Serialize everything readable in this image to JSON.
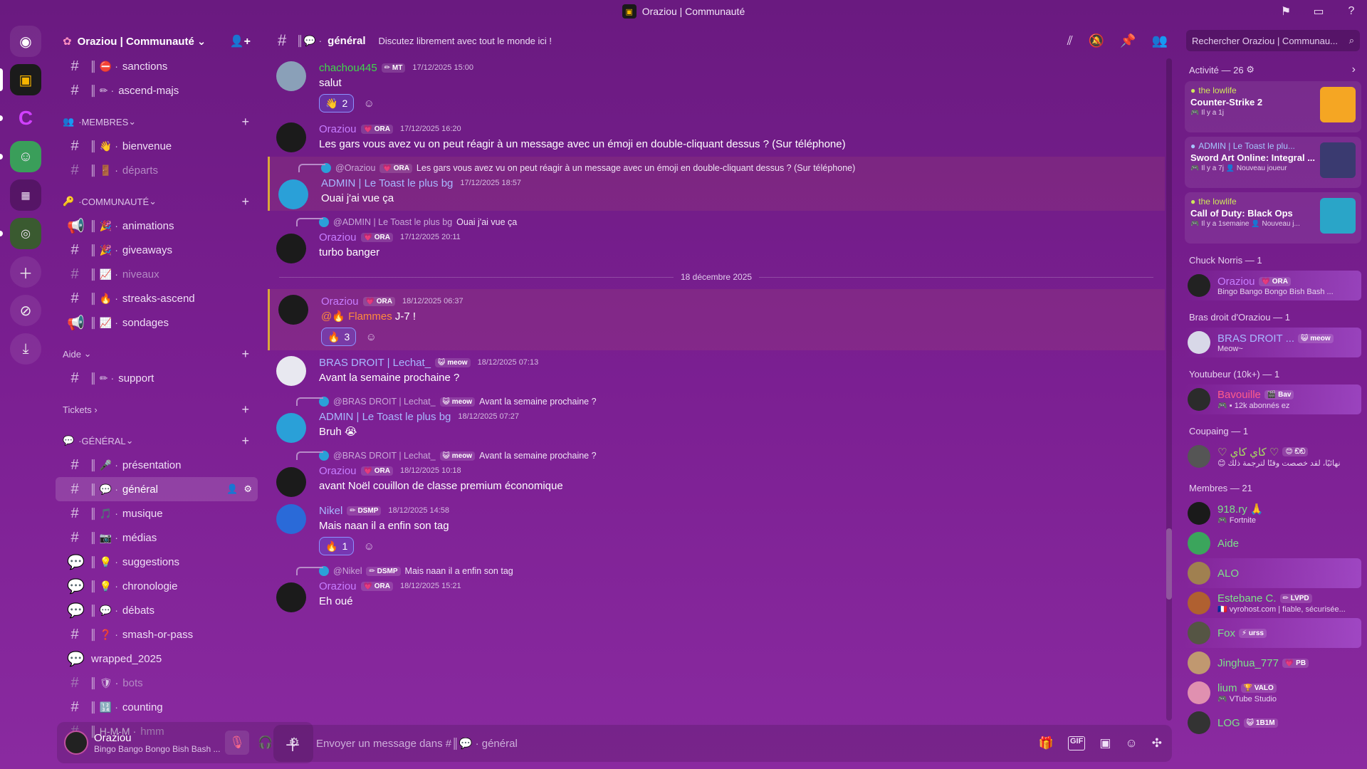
{
  "window": {
    "title": "Oraziou | Communauté"
  },
  "sidebar": {
    "guild_name": "Oraziou | Communauté",
    "top_channels": [
      {
        "name": "sanctions",
        "emoji": "⛔",
        "muted": false
      },
      {
        "name": "ascend-majs",
        "emoji": "✏",
        "muted": false
      }
    ],
    "cat_membres": "MEMBRES",
    "membres_channels": [
      {
        "name": "bienvenue",
        "emoji": "👋",
        "muted": false
      },
      {
        "name": "départs",
        "emoji": "🚪",
        "muted": true
      }
    ],
    "cat_communaute": "COMMUNAUTÉ",
    "communaute_channels": [
      {
        "name": "animations",
        "emoji": "🎉",
        "muted": false,
        "icon": "📢"
      },
      {
        "name": "giveaways",
        "emoji": "🎉",
        "muted": false,
        "icon": "#"
      },
      {
        "name": "niveaux",
        "emoji": "📈",
        "muted": true,
        "icon": "#"
      },
      {
        "name": "streaks-ascend",
        "emoji": "🔥",
        "muted": false,
        "icon": "#"
      },
      {
        "name": "sondages",
        "emoji": "📈",
        "muted": false,
        "icon": "📢"
      }
    ],
    "cat_aide": "Aide",
    "aide_channels": [
      {
        "name": "support",
        "emoji": "✏",
        "muted": false
      }
    ],
    "cat_tickets": "Tickets",
    "cat_general": "GÉNÉRAL",
    "general_channels": [
      {
        "name": "présentation",
        "emoji": "🎤",
        "muted": false,
        "icon": "#"
      },
      {
        "name": "général",
        "emoji": "💬",
        "muted": false,
        "icon": "#",
        "active": true
      },
      {
        "name": "musique",
        "emoji": "🎵",
        "muted": false,
        "icon": "#"
      },
      {
        "name": "médias",
        "emoji": "📷",
        "muted": false,
        "icon": "#"
      },
      {
        "name": "suggestions",
        "emoji": "💡",
        "muted": false,
        "icon": "💬"
      },
      {
        "name": "chronologie",
        "emoji": "💡",
        "muted": false,
        "icon": "💬"
      },
      {
        "name": "débats",
        "emoji": "💬",
        "muted": false,
        "icon": "💬"
      },
      {
        "name": "smash-or-pass",
        "emoji": "❓",
        "muted": false,
        "icon": "#"
      },
      {
        "name": "wrapped_2025",
        "emoji": "",
        "muted": false,
        "icon": "💬",
        "plain": true
      },
      {
        "name": "bots",
        "emoji": "🛡",
        "muted": true,
        "icon": "#"
      },
      {
        "name": "counting",
        "emoji": "🔢",
        "muted": false,
        "icon": "#"
      },
      {
        "name": "hmm",
        "emoji": "H-M-M",
        "muted": true,
        "icon": "#"
      }
    ],
    "user": {
      "name": "Oraziou",
      "status": "Bingo Bango Bongo Bish Bash ..."
    }
  },
  "chat": {
    "channel": "général",
    "topic": "Discutez librement avec tout le monde ici !",
    "search_placeholder": "Rechercher Oraziou | Communau...",
    "composer_placeholder": "Envoyer un message dans #║💬 · général",
    "date_divider": "18 décembre 2025",
    "messages": [
      {
        "author": "chachou445",
        "tag": "✏ MT",
        "color": "#3fd94a",
        "time": "17/12/2025 15:00",
        "text": "salut",
        "reactions": [
          {
            "emoji": "👋",
            "count": "2"
          }
        ]
      },
      {
        "author": "Oraziou",
        "tag": "💗 ORA",
        "color": "#c77dff",
        "time": "17/12/2025 16:20",
        "text": "Les gars vous avez vu on peut réagir à un message avec un émoji en double-cliquant dessus ? (Sur téléphone)"
      },
      {
        "reply_author": "@Oraziou",
        "reply_tag": "💗 ORA",
        "reply_text": "Les gars vous avez vu on peut réagir à un message avec un émoji en double-cliquant dessus ? (Sur téléphone)",
        "author": "ADMIN | Le Toast le plus bg",
        "color": "#a8b8ff",
        "time": "17/12/2025 18:57",
        "text": "Ouai j'ai vue ça",
        "mention": true
      },
      {
        "reply_author": "@ADMIN | Le Toast le plus bg",
        "reply_text": "Ouai j'ai vue ça",
        "author": "Oraziou",
        "tag": "💗 ORA",
        "color": "#c77dff",
        "time": "17/12/2025 20:11",
        "text": "turbo banger"
      },
      {
        "author": "Oraziou",
        "tag": "💗 ORA",
        "color": "#c77dff",
        "time": "18/12/2025 06:37",
        "ping": "@🔥 Flammes",
        "text": " J-7 !",
        "reactions": [
          {
            "emoji": "🔥",
            "count": "3"
          }
        ],
        "mention": true
      },
      {
        "author": "BRAS DROIT | Lechat_",
        "tag": "😺 meow",
        "color": "#a8b8ff",
        "time": "18/12/2025 07:13",
        "text": "Avant la semaine prochaine ?"
      },
      {
        "reply_author": "@BRAS DROIT | Lechat_",
        "reply_tag": "😺 meow",
        "reply_text": "Avant la semaine prochaine ?",
        "author": "ADMIN | Le Toast le plus bg",
        "color": "#a8b8ff",
        "time": "18/12/2025 07:27",
        "text": "Bruh 😭"
      },
      {
        "reply_author": "@BRAS DROIT | Lechat_",
        "reply_tag": "😺 meow",
        "reply_text": "Avant la semaine prochaine ?",
        "author": "Oraziou",
        "tag": "💗 ORA",
        "color": "#c77dff",
        "time": "18/12/2025 10:18",
        "text": "avant Noël couillon de classe premium économique"
      },
      {
        "author": "Nikel",
        "tag": "✏ DSMP",
        "color": "#a8b8ff",
        "time": "18/12/2025 14:58",
        "text": "Mais naan il a enfin son tag",
        "reactions": [
          {
            "emoji": "🔥",
            "count": "1"
          }
        ]
      },
      {
        "reply_author": "@Nikel",
        "reply_tag": "✏ DSMP",
        "reply_text": "Mais naan il a enfin son tag",
        "author": "Oraziou",
        "tag": "💗 ORA",
        "color": "#c77dff",
        "time": "18/12/2025 15:21",
        "text": "Eh oué"
      }
    ]
  },
  "members": {
    "activity_header": "Activité — 26",
    "activities": [
      {
        "user": "the lowlife",
        "game": "Counter-Strike 2",
        "sub": "🎮 Il y a 1j",
        "img_color": "#f5a623",
        "blue": false
      },
      {
        "user": "ADMIN | Le Toast le plu...",
        "game": "Sword Art Online: Integral ...",
        "sub": "🎮 Il y a 7j  👤 Nouveau joueur",
        "img_color": "#3a3a70",
        "blue": true
      },
      {
        "user": "the lowlife",
        "game": "Call of Duty: Black Ops",
        "sub": "🎮 Il y a 1semaine  👤 Nouveau j...",
        "img_color": "#2aa5c8",
        "blue": false
      }
    ],
    "groups": [
      {
        "title": "Chuck Norris — 1",
        "list": [
          {
            "name": "Oraziou",
            "tag": "💗 ORA",
            "color": "#c77dff",
            "sub": "Bingo Bango Bongo Bish Bash ...",
            "banner": true,
            "av": "#222"
          }
        ]
      },
      {
        "title": "Bras droit d'Oraziou — 1",
        "list": [
          {
            "name": "BRAS DROIT ...",
            "tag": "😺 meow",
            "color": "#a8b8ff",
            "sub": "Meow~",
            "banner": true,
            "av": "#d8d8e8"
          }
        ]
      },
      {
        "title": "Youtubeur (10k+) — 1",
        "list": [
          {
            "name": "Bavouille",
            "tag": "🎬 Bav",
            "color": "#ff5b8a",
            "sub": "🎮 ▪ 12k abonnés ez",
            "banner": true,
            "av": "#2b2b2b"
          }
        ]
      },
      {
        "title": "Coupaing — 1",
        "list": [
          {
            "name": "♡ كاي كاي ♡",
            "tag": "😊 ඞඞ",
            "color": "#a8e060",
            "sub": "😊 نهائيًا، لقد خصصت وقتًا لترجمة ذلك",
            "banner": false,
            "av": "#555"
          }
        ]
      },
      {
        "title": "Membres — 21",
        "list": [
          {
            "name": "918.ry 🙏",
            "tag": "",
            "color": "#7ee08a",
            "sub": "🎮 Fortnite",
            "banner": false,
            "av": "#1a1a1a"
          },
          {
            "name": "Aide",
            "tag": "",
            "color": "#7ee08a",
            "sub": "",
            "banner": false,
            "av": "#3ba55c"
          },
          {
            "name": "ALO",
            "tag": "",
            "color": "#7ee08a",
            "sub": "",
            "banner": true,
            "av": "#a08050"
          },
          {
            "name": "Estebane C.",
            "tag": "✏ LVPD",
            "color": "#7ee08a",
            "sub": "🇫🇷 vyrohost.com | fiable, sécurisée...",
            "banner": false,
            "av": "#b06030"
          },
          {
            "name": "Fox",
            "tag": "⚡ urss",
            "color": "#7ee08a",
            "sub": "",
            "banner": true,
            "av": "#554"
          },
          {
            "name": "Jinghua_777",
            "tag": "💗 PB",
            "color": "#7ee08a",
            "sub": "",
            "banner": false,
            "av": "#c09870"
          },
          {
            "name": "lium",
            "tag": "🏆 VALO",
            "color": "#7ee08a",
            "sub": "🎮 VTube Studio",
            "banner": false,
            "av": "#e090b0"
          },
          {
            "name": "LOG",
            "tag": "😺 1B1M",
            "color": "#7ee08a",
            "sub": "",
            "banner": false,
            "av": "#333"
          }
        ]
      }
    ]
  }
}
